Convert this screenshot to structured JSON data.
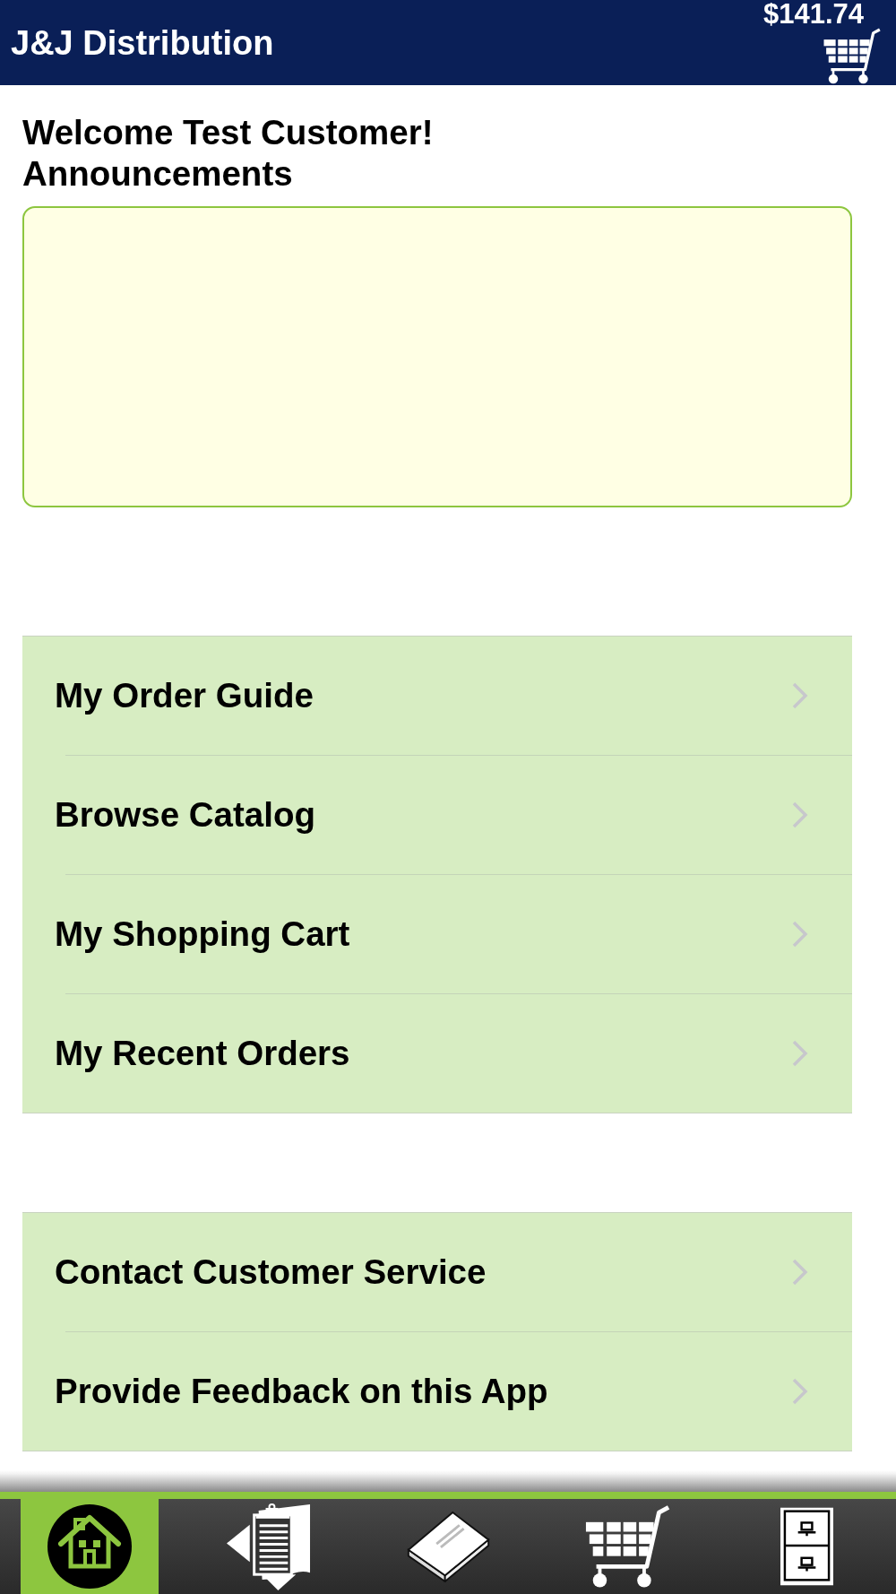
{
  "header": {
    "title": "J&J Distribution",
    "cart_total": "$141.74"
  },
  "welcome": "Welcome Test Customer!",
  "announcements": {
    "heading": "Announcements"
  },
  "menu_groups": [
    {
      "items": [
        {
          "label": "My Order Guide"
        },
        {
          "label": "Browse Catalog"
        },
        {
          "label": "My Shopping Cart"
        },
        {
          "label": "My Recent Orders"
        }
      ]
    },
    {
      "items": [
        {
          "label": "Contact Customer Service"
        },
        {
          "label": "Provide Feedback on this App"
        }
      ]
    }
  ],
  "tab_bar": {
    "tabs": [
      {
        "kind": "home",
        "selected": true
      },
      {
        "kind": "clipboard",
        "selected": false
      },
      {
        "kind": "book",
        "selected": false
      },
      {
        "kind": "cart",
        "selected": false
      },
      {
        "kind": "cabinet",
        "selected": false
      }
    ]
  }
}
